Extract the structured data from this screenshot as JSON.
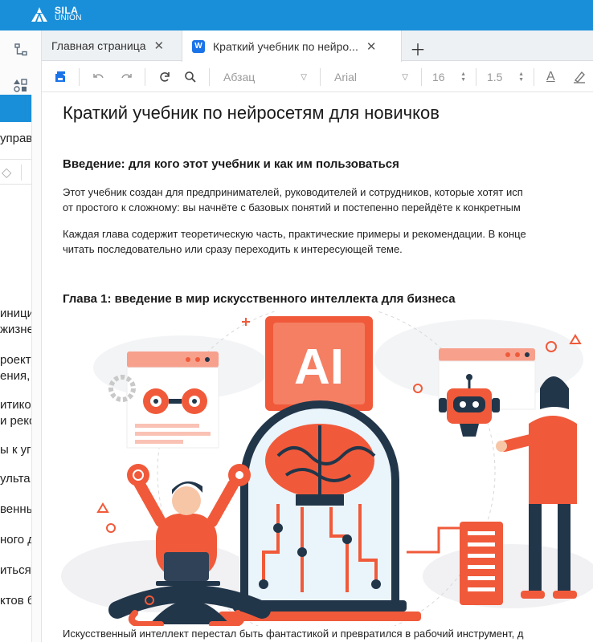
{
  "brand": {
    "line1": "SILA",
    "line2": "UNION"
  },
  "tabs": [
    {
      "label": "Главная страница",
      "active": false
    },
    {
      "label": "Краткий учебник по нейро...",
      "active": true,
      "badge": "W"
    }
  ],
  "toolbar": {
    "style": "Абзац",
    "font": "Arial",
    "size": "16",
    "line_spacing": "1.5",
    "text_color_glyph": "A"
  },
  "under_panel": {
    "items": [
      "управ",
      "иници",
      "жизне",
      "роект",
      "ения,",
      "итико",
      "и реко",
      "ы к уг",
      "ульта",
      "венны",
      "ного д",
      "иться",
      "ктов б"
    ]
  },
  "document": {
    "title": "Краткий учебник по нейросетям для новичков",
    "intro_heading": "Введение: для кого этот учебник и как им пользоваться",
    "intro_p1_l1": "Этот учебник создан для предпринимателей, руководителей и сотрудников, которые хотят исп",
    "intro_p1_l2": "от простого к сложному: вы начнёте с базовых понятий и постепенно перейдёте к конкретным",
    "intro_p2_l1": "Каждая глава содержит теоретическую часть, практические примеры и рекомендации. В конце",
    "intro_p2_l2": "читать последовательно или сразу переходить к интересующей теме.",
    "ch1_heading": "Глава 1: введение в мир искусственного интеллекта для бизнеса",
    "illustration_label": "AI",
    "closing_line": "Искусственный интеллект перестал быть фантастикой и превратился в рабочий инструмент, д"
  },
  "colors": {
    "brand": "#1a8fd9",
    "accent": "#f05a3a",
    "dark": "#22364a"
  }
}
